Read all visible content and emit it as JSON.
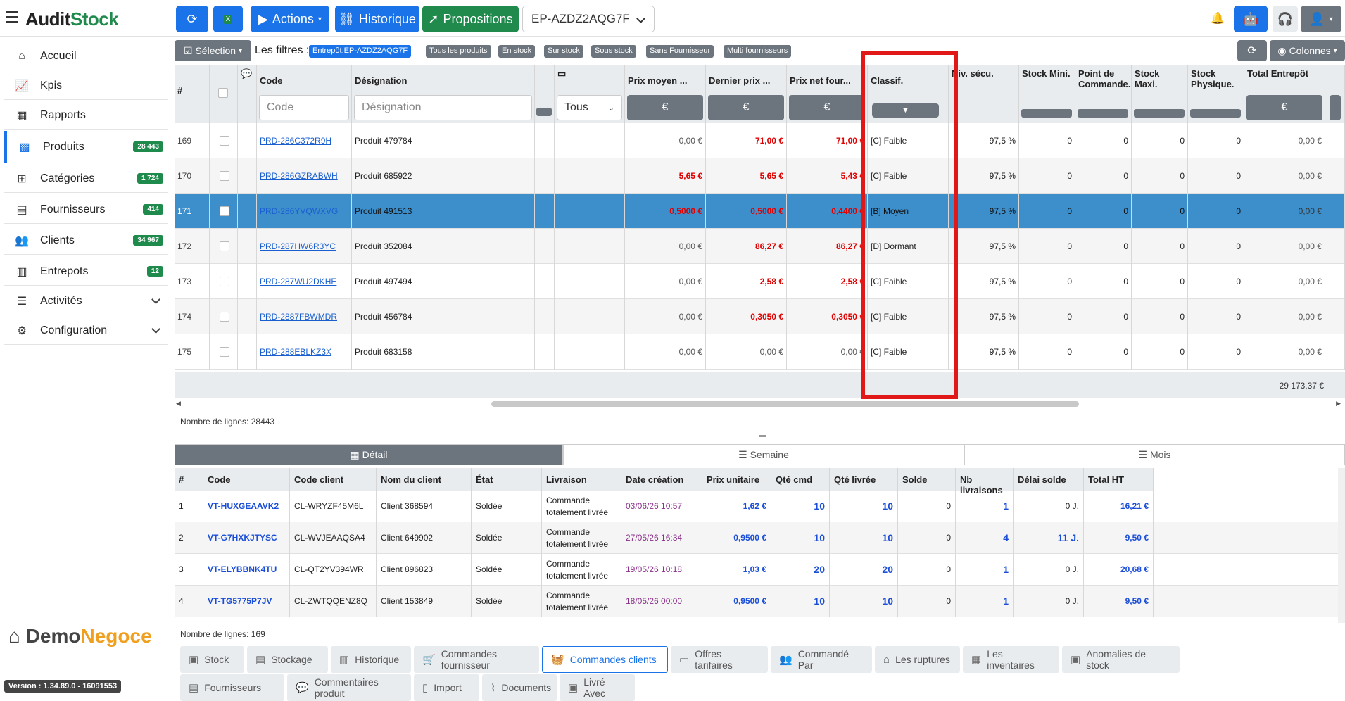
{
  "app": {
    "brand_a": "Audit",
    "brand_b": "Stock",
    "warehouse": "EP-AZDZ2AQG7F",
    "version": "Version : 1.34.89.0 - 16091553",
    "logo_a": "Demo",
    "logo_b": "Negoce"
  },
  "toolbar": {
    "actions": "Actions",
    "historique": "Historique",
    "propositions": "Propositions",
    "colonnes": "Colonnes"
  },
  "sidebar": [
    {
      "label": "Accueil",
      "icon": "home-icon",
      "badge": ""
    },
    {
      "label": "Kpis",
      "icon": "chart-line-icon",
      "badge": ""
    },
    {
      "label": "Rapports",
      "icon": "calendar-icon",
      "badge": ""
    },
    {
      "label": "Produits",
      "icon": "qrcode-icon",
      "badge": "28 443"
    },
    {
      "label": "Catégories",
      "icon": "folder-tree-icon",
      "badge": "1 724"
    },
    {
      "label": "Fournisseurs",
      "icon": "warehouse-icon",
      "badge": "414"
    },
    {
      "label": "Clients",
      "icon": "users-icon",
      "badge": "34 967"
    },
    {
      "label": "Entrepots",
      "icon": "building-icon",
      "badge": "12"
    },
    {
      "label": "Activités",
      "icon": "sliders-icon",
      "badge": ""
    },
    {
      "label": "Configuration",
      "icon": "gear-icon",
      "badge": ""
    }
  ],
  "filters": {
    "selection": "Sélection",
    "label": "Les filtres :",
    "chips": [
      "Entrepôt:EP-AZDZ2AQG7F",
      "Tous les produits",
      "En stock",
      "Sur stock",
      "Sous stock",
      "Sans Fournisseur",
      "Multi fournisseurs"
    ]
  },
  "grid": {
    "headers": {
      "num": "#",
      "code": "Code",
      "designation": "Désignation",
      "prix_moyen": "Prix moyen ...",
      "dernier_prix": "Dernier prix ...",
      "prix_net": "Prix net four...",
      "classif": "Classif.",
      "niv": "Niv. sécu.",
      "stock_mini": "Stock Mini.",
      "point_cmd": "Point de Commande.",
      "stock_maxi": "Stock Maxi.",
      "stock_phys": "Stock Physique.",
      "total": "Total Entrepôt"
    },
    "placeholders": {
      "code": "Code",
      "designation": "Désignation"
    },
    "tous": "Tous",
    "euro": "€",
    "rows": [
      {
        "n": "169",
        "code": "PRD-286C372R9H",
        "des": "Produit 479784",
        "pm": "0,00 €",
        "dp": "71,00 €",
        "pn": "71,00 €",
        "cls": "[C] Faible",
        "niv": "97,5 %",
        "smin": "0",
        "pc": "0",
        "smax": "0",
        "sp": "0",
        "tot": "0,00 €"
      },
      {
        "n": "170",
        "code": "PRD-286GZRABWH",
        "des": "Produit 685922",
        "pm": "5,65 €",
        "dp": "5,65 €",
        "pn": "5,43 €",
        "cls": "[C] Faible",
        "niv": "97,5 %",
        "smin": "0",
        "pc": "0",
        "smax": "0",
        "sp": "0",
        "tot": "0,00 €"
      },
      {
        "n": "171",
        "code": "PRD-286YVQWXVG",
        "des": "Produit 491513",
        "pm": "0,5000 €",
        "dp": "0,5000 €",
        "pn": "0,4400 €",
        "cls": "[B] Moyen",
        "niv": "97,5 %",
        "smin": "0",
        "pc": "0",
        "smax": "0",
        "sp": "0",
        "tot": "0,00 €"
      },
      {
        "n": "172",
        "code": "PRD-287HW6R3YC",
        "des": "Produit 352084",
        "pm": "0,00 €",
        "dp": "86,27 €",
        "pn": "86,27 €",
        "cls": "[D] Dormant",
        "niv": "97,5 %",
        "smin": "0",
        "pc": "0",
        "smax": "0",
        "sp": "0",
        "tot": "0,00 €"
      },
      {
        "n": "173",
        "code": "PRD-287WU2DKHE",
        "des": "Produit 497494",
        "pm": "0,00 €",
        "dp": "2,58 €",
        "pn": "2,58 €",
        "cls": "[C] Faible",
        "niv": "97,5 %",
        "smin": "0",
        "pc": "0",
        "smax": "0",
        "sp": "0",
        "tot": "0,00 €"
      },
      {
        "n": "174",
        "code": "PRD-2887FBWMDR",
        "des": "Produit 456784",
        "pm": "0,00 €",
        "dp": "0,3050 €",
        "pn": "0,3050 €",
        "cls": "[C] Faible",
        "niv": "97,5 %",
        "smin": "0",
        "pc": "0",
        "smax": "0",
        "sp": "0",
        "tot": "0,00 €"
      },
      {
        "n": "175",
        "code": "PRD-288EBLKZ3X",
        "des": "Produit 683158",
        "pm": "0,00 €",
        "dp": "0,00 €",
        "pn": "0,00 €",
        "cls": "[C] Faible",
        "niv": "97,5 %",
        "smin": "0",
        "pc": "0",
        "smax": "0",
        "sp": "0",
        "tot": "0,00 €"
      }
    ],
    "footer_total": "29 173,37 €",
    "nb_lines": "Nombre de lignes: 28443"
  },
  "detail_tabs": [
    "Détail",
    "Semaine",
    "Mois"
  ],
  "orders": {
    "headers": [
      "#",
      "Code",
      "Code client",
      "Nom du client",
      "État",
      "Livraison",
      "Date création",
      "Prix unitaire",
      "Qté cmd",
      "Qté livrée",
      "Solde",
      "Nb livraisons",
      "Délai solde",
      "Total HT"
    ],
    "rows": [
      {
        "n": "1",
        "code": "VT-HUXGEAAVK2",
        "cc": "CL-WRYZF45M6L",
        "nom": "Client 368594",
        "etat": "Soldée",
        "liv": "Commande totalement livrée",
        "date": "03/06/26 10:57",
        "pu": "1,62 €",
        "qc": "10",
        "ql": "10",
        "solde": "0",
        "nb": "1",
        "delai": "0 J.",
        "tot": "16,21 €"
      },
      {
        "n": "2",
        "code": "VT-G7HXKJTYSC",
        "cc": "CL-WVJEAAQSA4",
        "nom": "Client 649902",
        "etat": "Soldée",
        "liv": "Commande totalement livrée",
        "date": "27/05/26 16:34",
        "pu": "0,9500 €",
        "qc": "10",
        "ql": "10",
        "solde": "0",
        "nb": "4",
        "delai": "11 J.",
        "tot": "9,50 €"
      },
      {
        "n": "3",
        "code": "VT-ELYBBNK4TU",
        "cc": "CL-QT2YV394WR",
        "nom": "Client 896823",
        "etat": "Soldée",
        "liv": "Commande totalement livrée",
        "date": "19/05/26 10:18",
        "pu": "1,03 €",
        "qc": "20",
        "ql": "20",
        "solde": "0",
        "nb": "1",
        "delai": "0 J.",
        "tot": "20,68 €"
      },
      {
        "n": "4",
        "code": "VT-TG5775P7JV",
        "cc": "CL-ZWTQQENZ8Q",
        "nom": "Client 153849",
        "etat": "Soldée",
        "liv": "Commande totalement livrée",
        "date": "18/05/26 00:00",
        "pu": "0,9500 €",
        "qc": "10",
        "ql": "10",
        "solde": "0",
        "nb": "1",
        "delai": "0 J.",
        "tot": "9,50 €"
      }
    ],
    "nb_lines": "Nombre de lignes: 169"
  },
  "bottom_tabs": [
    [
      "Stock",
      "Stockage",
      "Historique",
      "Commandes fournisseur",
      "Commandes clients",
      "Offres tarifaires",
      "Commandé Par",
      "Les ruptures",
      "Les inventaires",
      "Anomalies de stock"
    ],
    [
      "Fournisseurs",
      "Commentaires produit",
      "Import",
      "Documents",
      "Livré Avec"
    ]
  ]
}
